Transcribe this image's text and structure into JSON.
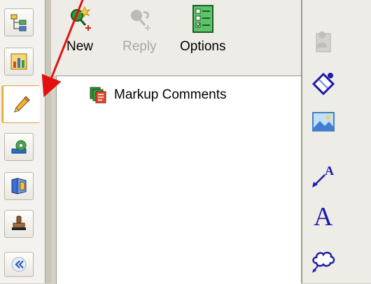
{
  "toolbar": {
    "new_label": "New",
    "reply_label": "Reply",
    "options_label": "Options"
  },
  "tree": {
    "items": [
      {
        "label": "Markup Comments",
        "icon": "markup-comments-icon"
      }
    ]
  },
  "left_tabs": [
    {
      "icon": "tree-structure-icon"
    },
    {
      "icon": "report-chart-icon"
    },
    {
      "icon": "pencil-markup-icon",
      "active": true
    },
    {
      "icon": "measure-tape-icon"
    },
    {
      "icon": "section-view-icon"
    },
    {
      "icon": "stamp-icon"
    },
    {
      "icon": "collapse-double-chevron-icon"
    }
  ],
  "right_tools": [
    {
      "icon": "document-person-icon",
      "enabled": false
    },
    {
      "icon": "rectangle-markup-icon"
    },
    {
      "icon": "image-markup-icon"
    },
    {
      "icon": "leader-text-icon"
    },
    {
      "icon": "text-markup-icon"
    },
    {
      "icon": "cloud-markup-icon"
    }
  ],
  "colors": {
    "annotation_arrow": "#e31010",
    "active_tab_accent": "#f5b33e",
    "markup_blue": "#1c1ca8"
  }
}
